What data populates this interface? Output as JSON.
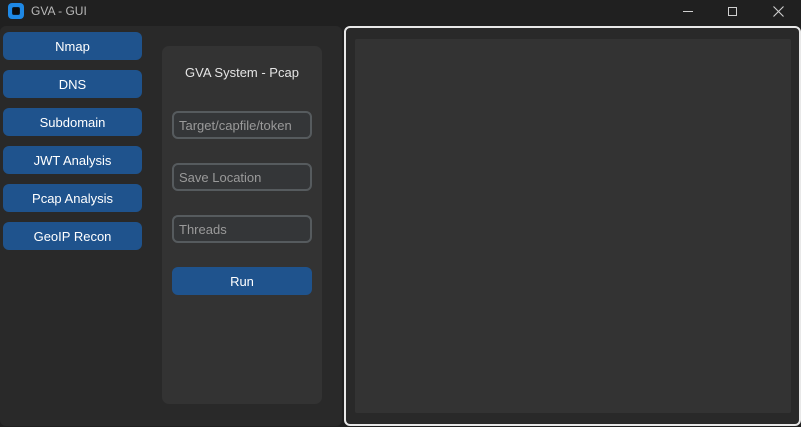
{
  "window": {
    "title": "GVA - GUI"
  },
  "sidebar": {
    "items": [
      {
        "label": "Nmap"
      },
      {
        "label": "DNS"
      },
      {
        "label": "Subdomain"
      },
      {
        "label": "JWT Analysis"
      },
      {
        "label": "Pcap Analysis"
      },
      {
        "label": "GeoIP Recon"
      }
    ]
  },
  "form": {
    "title": "GVA System - Pcap",
    "target_placeholder": "Target/capfile/token",
    "save_placeholder": "Save Location",
    "threads_placeholder": "Threads",
    "run_label": "Run"
  },
  "output": {
    "text": ""
  },
  "colors": {
    "button": "#1f538d",
    "panel": "#292929",
    "frame": "#333333",
    "accent_icon": "#1e88e5"
  },
  "icons": {
    "app": "app-icon",
    "minimize": "minimize-icon",
    "maximize": "maximize-icon",
    "close": "close-icon"
  }
}
